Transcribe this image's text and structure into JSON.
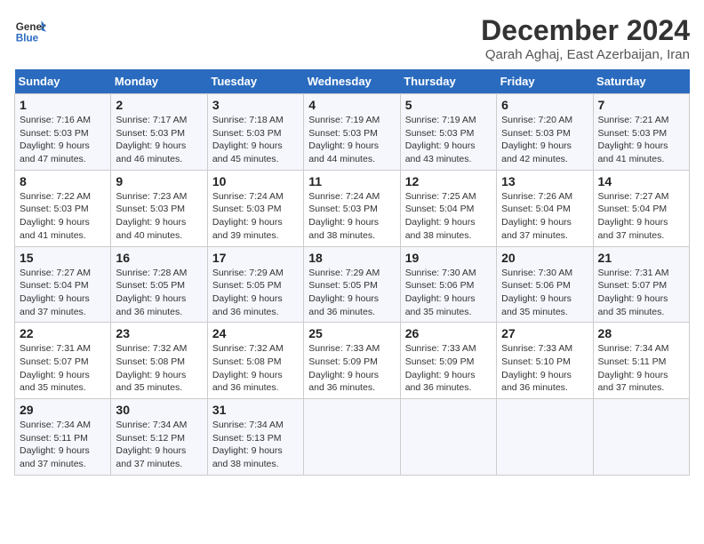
{
  "header": {
    "logo_line1": "General",
    "logo_line2": "Blue",
    "title": "December 2024",
    "subtitle": "Qarah Aghaj, East Azerbaijan, Iran"
  },
  "days_of_week": [
    "Sunday",
    "Monday",
    "Tuesday",
    "Wednesday",
    "Thursday",
    "Friday",
    "Saturday"
  ],
  "weeks": [
    [
      {
        "day": "1",
        "info": "Sunrise: 7:16 AM\nSunset: 5:03 PM\nDaylight: 9 hours and 47 minutes."
      },
      {
        "day": "2",
        "info": "Sunrise: 7:17 AM\nSunset: 5:03 PM\nDaylight: 9 hours and 46 minutes."
      },
      {
        "day": "3",
        "info": "Sunrise: 7:18 AM\nSunset: 5:03 PM\nDaylight: 9 hours and 45 minutes."
      },
      {
        "day": "4",
        "info": "Sunrise: 7:19 AM\nSunset: 5:03 PM\nDaylight: 9 hours and 44 minutes."
      },
      {
        "day": "5",
        "info": "Sunrise: 7:19 AM\nSunset: 5:03 PM\nDaylight: 9 hours and 43 minutes."
      },
      {
        "day": "6",
        "info": "Sunrise: 7:20 AM\nSunset: 5:03 PM\nDaylight: 9 hours and 42 minutes."
      },
      {
        "day": "7",
        "info": "Sunrise: 7:21 AM\nSunset: 5:03 PM\nDaylight: 9 hours and 41 minutes."
      }
    ],
    [
      {
        "day": "8",
        "info": "Sunrise: 7:22 AM\nSunset: 5:03 PM\nDaylight: 9 hours and 41 minutes."
      },
      {
        "day": "9",
        "info": "Sunrise: 7:23 AM\nSunset: 5:03 PM\nDaylight: 9 hours and 40 minutes."
      },
      {
        "day": "10",
        "info": "Sunrise: 7:24 AM\nSunset: 5:03 PM\nDaylight: 9 hours and 39 minutes."
      },
      {
        "day": "11",
        "info": "Sunrise: 7:24 AM\nSunset: 5:03 PM\nDaylight: 9 hours and 38 minutes."
      },
      {
        "day": "12",
        "info": "Sunrise: 7:25 AM\nSunset: 5:04 PM\nDaylight: 9 hours and 38 minutes."
      },
      {
        "day": "13",
        "info": "Sunrise: 7:26 AM\nSunset: 5:04 PM\nDaylight: 9 hours and 37 minutes."
      },
      {
        "day": "14",
        "info": "Sunrise: 7:27 AM\nSunset: 5:04 PM\nDaylight: 9 hours and 37 minutes."
      }
    ],
    [
      {
        "day": "15",
        "info": "Sunrise: 7:27 AM\nSunset: 5:04 PM\nDaylight: 9 hours and 37 minutes."
      },
      {
        "day": "16",
        "info": "Sunrise: 7:28 AM\nSunset: 5:05 PM\nDaylight: 9 hours and 36 minutes."
      },
      {
        "day": "17",
        "info": "Sunrise: 7:29 AM\nSunset: 5:05 PM\nDaylight: 9 hours and 36 minutes."
      },
      {
        "day": "18",
        "info": "Sunrise: 7:29 AM\nSunset: 5:05 PM\nDaylight: 9 hours and 36 minutes."
      },
      {
        "day": "19",
        "info": "Sunrise: 7:30 AM\nSunset: 5:06 PM\nDaylight: 9 hours and 35 minutes."
      },
      {
        "day": "20",
        "info": "Sunrise: 7:30 AM\nSunset: 5:06 PM\nDaylight: 9 hours and 35 minutes."
      },
      {
        "day": "21",
        "info": "Sunrise: 7:31 AM\nSunset: 5:07 PM\nDaylight: 9 hours and 35 minutes."
      }
    ],
    [
      {
        "day": "22",
        "info": "Sunrise: 7:31 AM\nSunset: 5:07 PM\nDaylight: 9 hours and 35 minutes."
      },
      {
        "day": "23",
        "info": "Sunrise: 7:32 AM\nSunset: 5:08 PM\nDaylight: 9 hours and 35 minutes."
      },
      {
        "day": "24",
        "info": "Sunrise: 7:32 AM\nSunset: 5:08 PM\nDaylight: 9 hours and 36 minutes."
      },
      {
        "day": "25",
        "info": "Sunrise: 7:33 AM\nSunset: 5:09 PM\nDaylight: 9 hours and 36 minutes."
      },
      {
        "day": "26",
        "info": "Sunrise: 7:33 AM\nSunset: 5:09 PM\nDaylight: 9 hours and 36 minutes."
      },
      {
        "day": "27",
        "info": "Sunrise: 7:33 AM\nSunset: 5:10 PM\nDaylight: 9 hours and 36 minutes."
      },
      {
        "day": "28",
        "info": "Sunrise: 7:34 AM\nSunset: 5:11 PM\nDaylight: 9 hours and 37 minutes."
      }
    ],
    [
      {
        "day": "29",
        "info": "Sunrise: 7:34 AM\nSunset: 5:11 PM\nDaylight: 9 hours and 37 minutes."
      },
      {
        "day": "30",
        "info": "Sunrise: 7:34 AM\nSunset: 5:12 PM\nDaylight: 9 hours and 37 minutes."
      },
      {
        "day": "31",
        "info": "Sunrise: 7:34 AM\nSunset: 5:13 PM\nDaylight: 9 hours and 38 minutes."
      },
      null,
      null,
      null,
      null
    ]
  ]
}
